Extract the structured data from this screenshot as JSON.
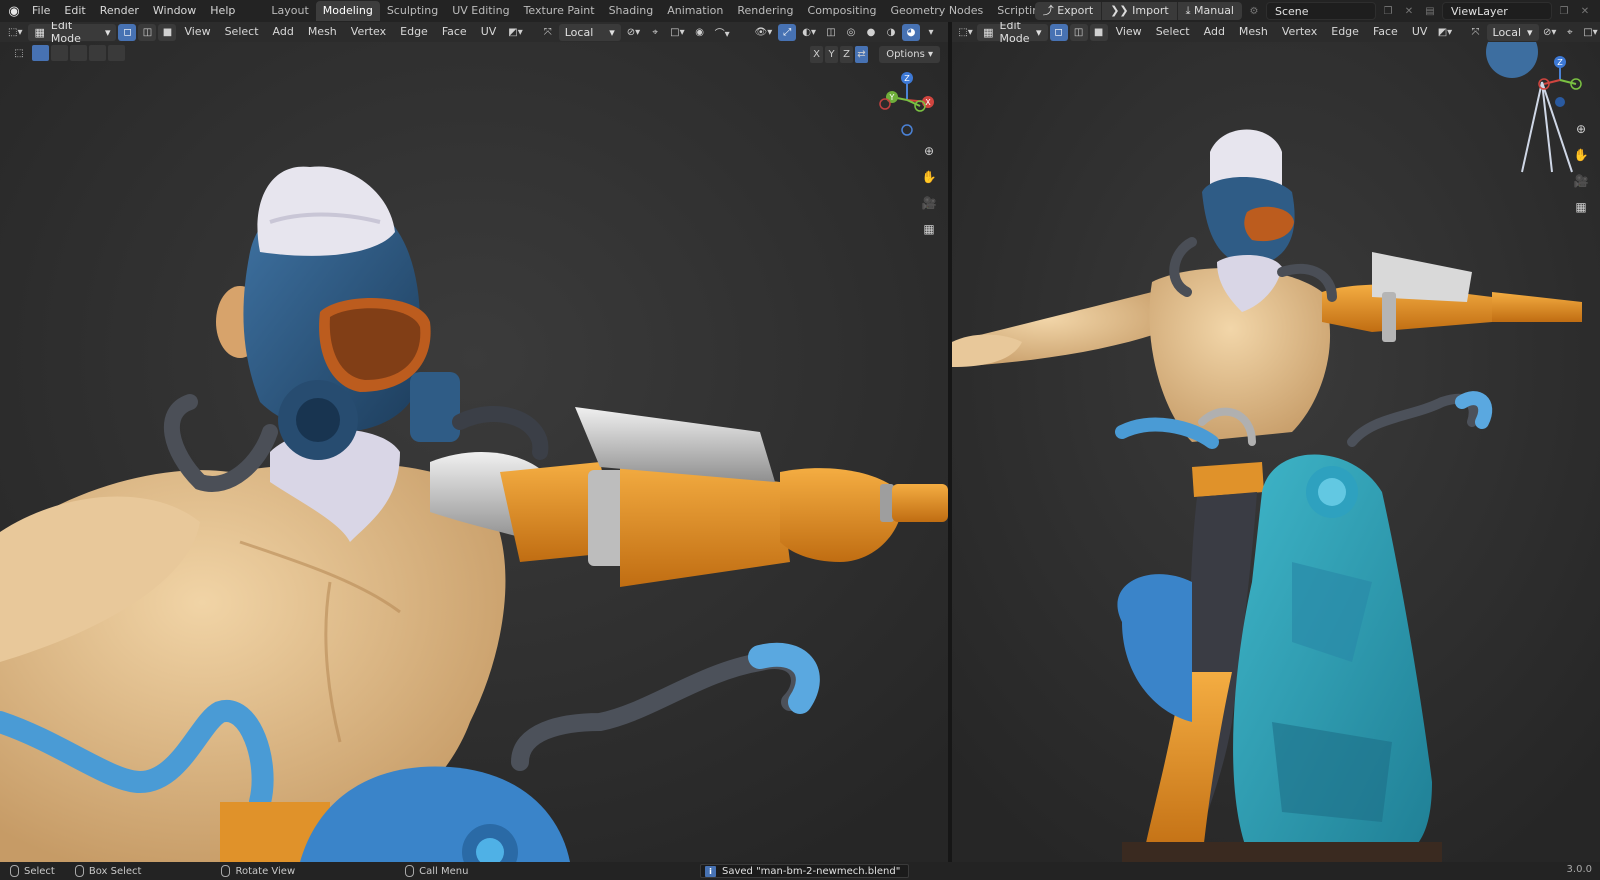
{
  "top_menu": [
    "File",
    "Edit",
    "Render",
    "Window",
    "Help"
  ],
  "workspaces": [
    {
      "label": "Layout",
      "active": false
    },
    {
      "label": "Modeling",
      "active": true
    },
    {
      "label": "Sculpting",
      "active": false
    },
    {
      "label": "UV Editing",
      "active": false
    },
    {
      "label": "Texture Paint",
      "active": false
    },
    {
      "label": "Shading",
      "active": false
    },
    {
      "label": "Animation",
      "active": false
    },
    {
      "label": "Rendering",
      "active": false
    },
    {
      "label": "Compositing",
      "active": false
    },
    {
      "label": "Geometry Nodes",
      "active": false
    },
    {
      "label": "Scripting",
      "active": false
    }
  ],
  "top_right": {
    "export_label": "Export",
    "import_label": "Import",
    "manual_label": "Manual",
    "scene_value": "Scene",
    "viewlayer_value": "ViewLayer"
  },
  "viewport_left": {
    "mode": "Edit Mode",
    "menus": [
      "View",
      "Select",
      "Add",
      "Mesh",
      "Vertex",
      "Edge",
      "Face",
      "UV"
    ],
    "transform_orientation": "Local",
    "options_label": "Options",
    "axis_labels": [
      "X",
      "Y",
      "Z"
    ]
  },
  "viewport_right": {
    "mode": "Edit Mode",
    "menus": [
      "View",
      "Select",
      "Add",
      "Mesh",
      "Vertex",
      "Edge",
      "Face",
      "UV"
    ],
    "transform_orientation": "Local"
  },
  "gizmo": {
    "x": "X",
    "y": "Y",
    "z": "Z"
  },
  "status": {
    "select": "Select",
    "box_select": "Box Select",
    "rotate_view": "Rotate View",
    "call_menu": "Call Menu",
    "message": "Saved \"man-bm-2-newmech.blend\"",
    "version": "3.0.0"
  },
  "colors": {
    "accent": "#4772b3",
    "skin": "#e5c293",
    "orange": "#e8962c",
    "mask_blue": "#2f5c86",
    "teal": "#2fa3b4"
  }
}
